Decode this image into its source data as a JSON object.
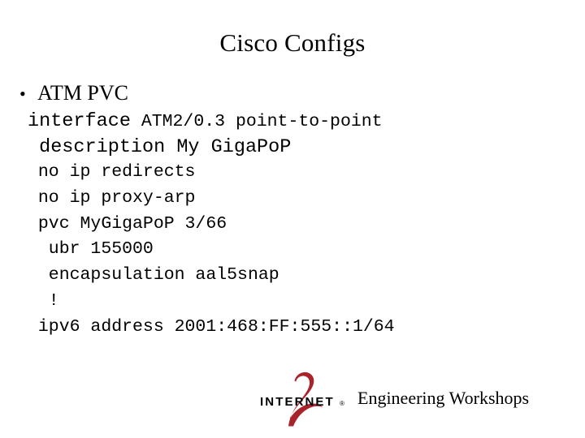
{
  "slide": {
    "title": "Cisco Configs",
    "bullet": {
      "marker": "•",
      "label": "ATM PVC"
    },
    "config": {
      "language": "cisco-ios",
      "lines": [
        {
          "indent": 0,
          "keyword": "interface",
          "rest": " ATM2/0.3 point-to-point",
          "text": "interface ATM2/0.3 point-to-point"
        },
        {
          "indent": 1,
          "keyword": "description",
          "rest": " My GigaPoP",
          "text": " description My GigaPoP"
        },
        {
          "indent": 1,
          "keyword": "",
          "rest": "",
          "text": " no ip redirects"
        },
        {
          "indent": 1,
          "keyword": "",
          "rest": "",
          "text": " no ip proxy-arp"
        },
        {
          "indent": 1,
          "keyword": "",
          "rest": "",
          "text": " pvc MyGigaPoP 3/66"
        },
        {
          "indent": 2,
          "keyword": "",
          "rest": "",
          "text": "  ubr 155000"
        },
        {
          "indent": 2,
          "keyword": "",
          "rest": "",
          "text": "  encapsulation aal5snap"
        },
        {
          "indent": 2,
          "keyword": "",
          "rest": "",
          "text": "  !"
        },
        {
          "indent": 1,
          "keyword": "",
          "rest": "",
          "text": " ipv6 address 2001:468:FF:555::1/64"
        }
      ]
    }
  },
  "footer": {
    "logo": {
      "name": "internet2-logo",
      "wordmark": "INTERNET",
      "registered_mark": "®",
      "numeral": "2",
      "wordmark_color": "#000000",
      "numeral_color": "#A9232B"
    },
    "text": "Engineering Workshops"
  }
}
